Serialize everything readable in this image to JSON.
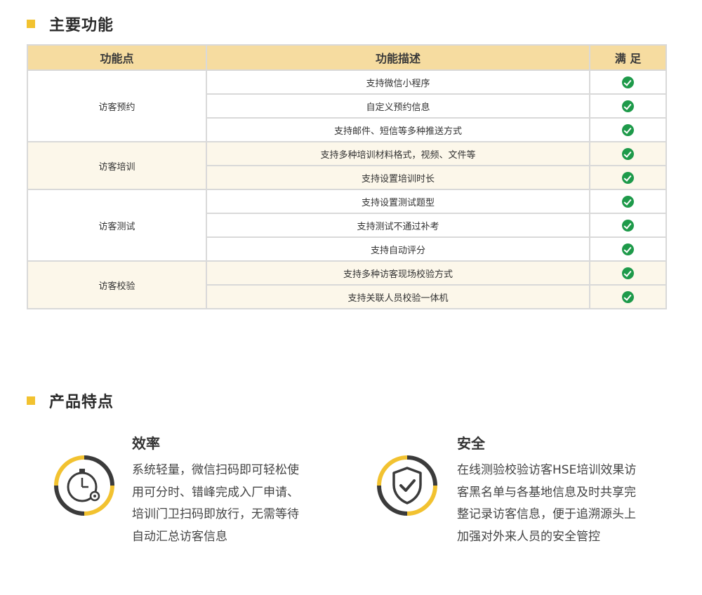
{
  "section1": {
    "title": "主要功能"
  },
  "table": {
    "headers": [
      "功能点",
      "功能描述",
      "满 足"
    ],
    "groups": [
      {
        "name": "访客预约",
        "items": [
          "支持微信小程序",
          "自定义预约信息",
          "支持邮件、短信等多种推送方式"
        ]
      },
      {
        "name": "访客培训",
        "items": [
          "支持多种培训材料格式，视频、文件等",
          "支持设置培训时长"
        ]
      },
      {
        "name": "访客测试",
        "items": [
          "支持设置测试题型",
          "支持测试不通过补考",
          "支持自动评分"
        ]
      },
      {
        "name": "访客校验",
        "items": [
          "支持多种访客现场校验方式",
          "支持关联人员校验一体机"
        ]
      }
    ]
  },
  "section2": {
    "title": "产品特点"
  },
  "features": {
    "efficiency": {
      "title": "效率",
      "icon": "stopwatch-gear-icon",
      "lines": [
        "系统轻量，微信扫码即可轻松使",
        "用可分时、错峰完成入厂申请、",
        "培训门卫扫码即放行，无需等待",
        "自动汇总访客信息"
      ]
    },
    "security": {
      "title": "安全",
      "icon": "shield-check-icon",
      "lines": [
        "在线测验校验访客HSE培训效果访",
        "客黑名单与各基地信息及时共享完",
        "整记录访客信息，便于追溯源头上",
        "加强对外来人员的安全管控"
      ]
    }
  },
  "colors": {
    "accent": "#f2c230",
    "header_bg": "#f6dca0",
    "alt_row": "#fcf7ea",
    "check": "#1e9a4a",
    "ring_dark": "#3b3b3b"
  }
}
